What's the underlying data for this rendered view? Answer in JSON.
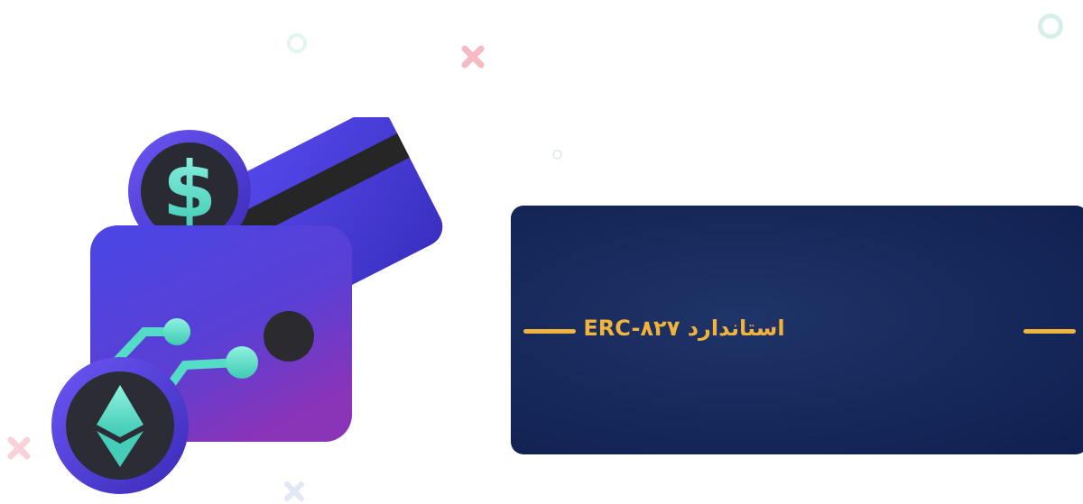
{
  "banner": {
    "title": "استاندارد  ERC-۸۲۷"
  },
  "illustration": {
    "subject": "wallet-with-card-dollar-coin-and-ethereum-coin",
    "coin_symbol": "$"
  },
  "colors": {
    "background": "#ffffff",
    "banner": "#16285a",
    "accent": "#f2b33d",
    "wallet": "#4b3fd8",
    "teal": "#58e1c9"
  }
}
